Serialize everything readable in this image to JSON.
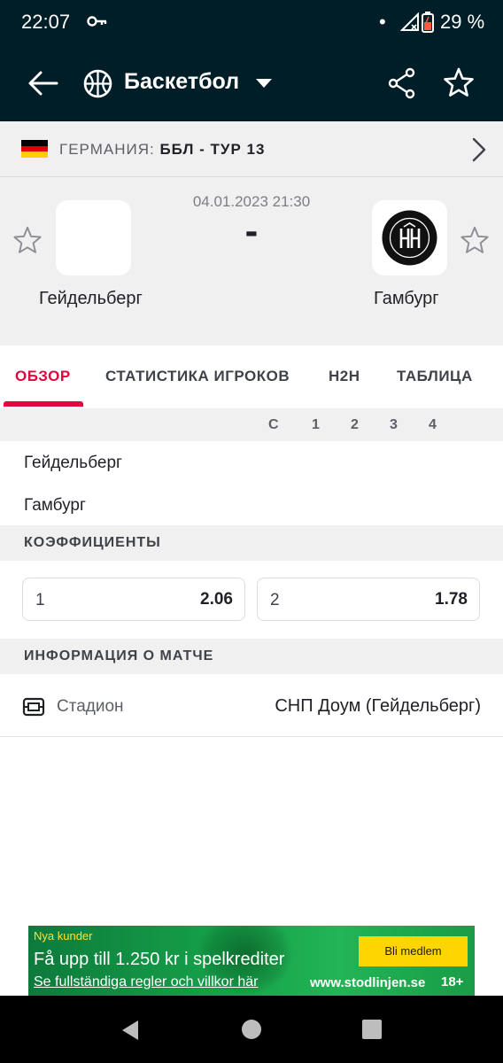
{
  "status_bar": {
    "time": "22:07",
    "battery_percent": "29 %"
  },
  "app_bar": {
    "title": "Баскетбол",
    "icons": [
      "arrow-left-icon",
      "basketball-icon",
      "chevron-down-icon",
      "share-icon",
      "star-icon"
    ]
  },
  "league": {
    "country": "ГЕРМАНИЯ:",
    "competition": "ББЛ - ТУР 13",
    "flag_colors": [
      "#000000",
      "#dd0000",
      "#ffce00"
    ]
  },
  "match": {
    "datetime": "04.01.2023 21:30",
    "score": "-",
    "home": {
      "name": "Гейдельберг"
    },
    "away": {
      "name": "Гамбург",
      "logo_text": "VEOLIA TOWERS HAMBURG"
    }
  },
  "tabs": [
    {
      "label": "ОБЗОР",
      "active": true
    },
    {
      "label": "СТАТИСТИКА ИГРОКОВ",
      "active": false
    },
    {
      "label": "H2H",
      "active": false
    },
    {
      "label": "ТАБЛИЦА",
      "active": false
    }
  ],
  "score_table": {
    "columns": [
      "С",
      "1",
      "2",
      "3",
      "4"
    ],
    "rows": [
      {
        "team": "Гейдельберг"
      },
      {
        "team": "Гамбург"
      }
    ]
  },
  "odds": {
    "header": "КОЭФФИЦИЕНТЫ",
    "items": [
      {
        "label": "1",
        "value": "2.06"
      },
      {
        "label": "2",
        "value": "1.78"
      }
    ]
  },
  "match_info": {
    "header": "ИНФОРМАЦИЯ О МАТЧЕ",
    "venue_label": "Стадион",
    "venue_value": "СНП Доум (Гейдельберг)"
  },
  "ad": {
    "tagline": "Nya kunder",
    "headline": "Få upp till 1.250 kr i spelkrediter",
    "terms": "Se fullständiga regler och villkor här",
    "cta": "Bli medlem",
    "url": "www.stodlinjen.se",
    "age_limit": "18+",
    "colors": {
      "background": "#16a34a",
      "cta": "#ffd500",
      "tagline": "#f7e43c"
    }
  },
  "colors": {
    "header_bg": "#001e28",
    "accent": "#e0073d",
    "panel_bg": "#f0f0f0"
  }
}
